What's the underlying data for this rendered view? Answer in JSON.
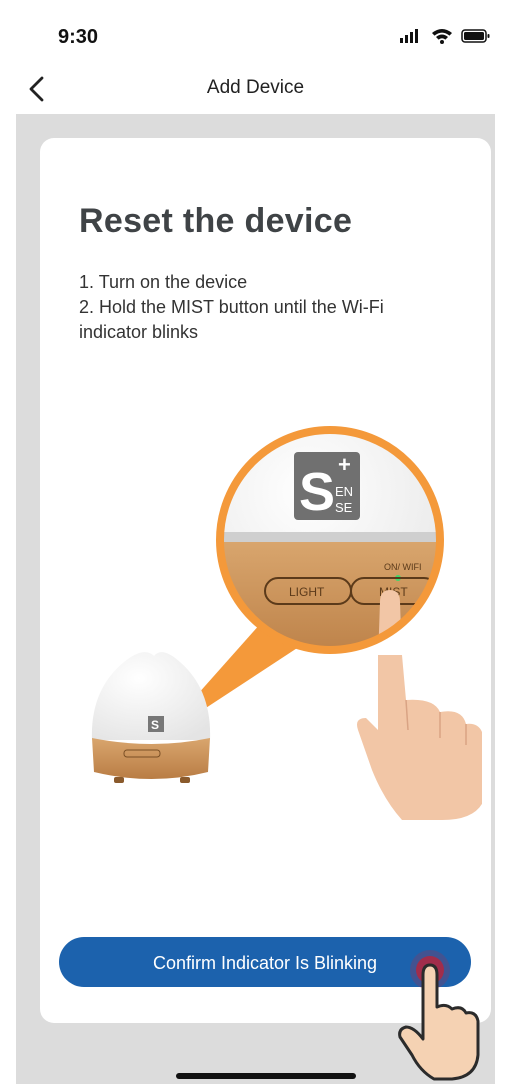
{
  "status_bar": {
    "time": "9:30",
    "icons": [
      "signal-icon",
      "wifi-icon",
      "battery-icon"
    ]
  },
  "nav": {
    "title": "Add Device",
    "back_icon": "chevron-left-icon"
  },
  "card": {
    "title": "Reset the device",
    "steps": [
      "1. Turn on the device",
      "2. Hold the MIST button until the Wi-Fi",
      "indicator blinks"
    ],
    "illustration": {
      "logo_letter": "S",
      "logo_plus": "+",
      "logo_small_1": "EN",
      "logo_small_2": "SE",
      "indicator_label": "ON/ WIFI",
      "button_left": "LIGHT",
      "button_right": "MIST"
    },
    "confirm_button": "Confirm Indicator Is Blinking"
  },
  "colors": {
    "accent": "#1c62ad",
    "orange": "#f4993a",
    "wood": "#c9925a",
    "background": "#dcdcdc"
  }
}
